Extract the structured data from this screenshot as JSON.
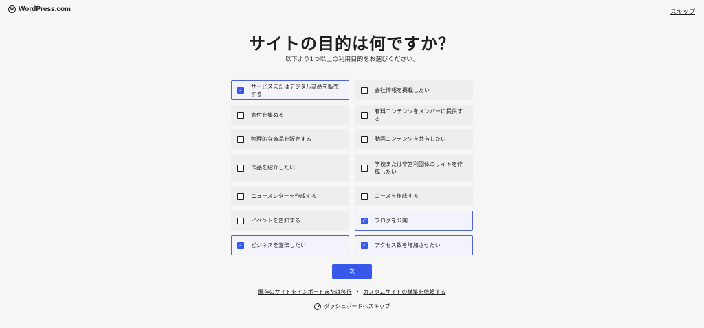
{
  "header": {
    "logo_text": "WordPress.com",
    "skip_label": "スキップ"
  },
  "main": {
    "title": "サイトの目的は何ですか？",
    "subtitle": "以下より1つ以上の利用目的をお選びください。",
    "options": [
      {
        "label": "サービスまたはデジタル商品を販売する",
        "checked": true
      },
      {
        "label": "会社情報を掲載したい",
        "checked": false
      },
      {
        "label": "寄付を集める",
        "checked": false
      },
      {
        "label": "有料コンテンツをメンバーに提供する",
        "checked": false
      },
      {
        "label": "物理的な商品を販売する",
        "checked": false
      },
      {
        "label": "動画コンテンツを共有したい",
        "checked": false
      },
      {
        "label": "作品を紹介したい",
        "checked": false
      },
      {
        "label": "学校または非営利団体のサイトを作成したい",
        "checked": false
      },
      {
        "label": "ニュースレターを作成する",
        "checked": false
      },
      {
        "label": "コースを作成する",
        "checked": false
      },
      {
        "label": "イベントを告知する",
        "checked": false
      },
      {
        "label": "ブログを公開",
        "checked": true
      },
      {
        "label": "ビジネスを宣伝したい",
        "checked": true
      },
      {
        "label": "アクセス数を増加させたい",
        "checked": true
      }
    ],
    "next_label": "次",
    "import_link": "既存のサイトをインポートまたは移行",
    "separator": "•",
    "custom_link": "カスタムサイトの構築を依頼する",
    "dashboard_link": "ダッシュボードへスキップ"
  },
  "colors": {
    "accent": "#3858e9",
    "background": "#f6f6f7",
    "option_bg": "#eeeeef"
  }
}
